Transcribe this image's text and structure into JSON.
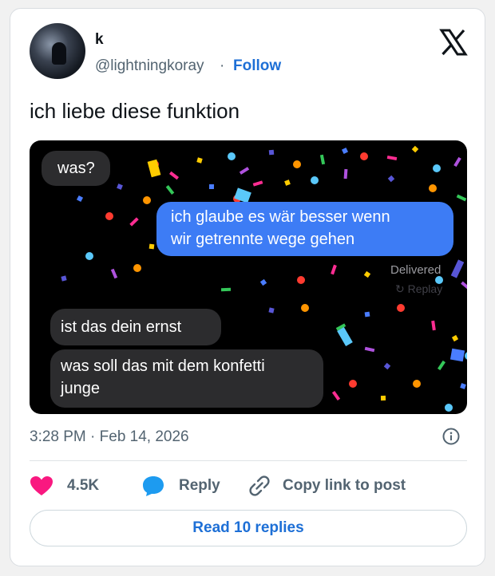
{
  "author": {
    "name": "k",
    "handle": "@lightningkoray",
    "separator": "·",
    "follow_label": "Follow"
  },
  "tweet": {
    "text": "ich liebe diese funktion",
    "timestamp": "3:28 PM · Feb 14, 2026"
  },
  "media": {
    "messages": [
      {
        "side": "left",
        "text": "was?"
      },
      {
        "side": "right",
        "line1": "ich glaube es wär besser wenn",
        "line2": "wir getrennte wege gehen"
      },
      {
        "side": "left",
        "text": "ist das dein ernst"
      },
      {
        "side": "left",
        "line1": "was soll das mit dem konfetti",
        "line2": "junge"
      }
    ],
    "status": "Delivered",
    "replay_label": "↻ Replay"
  },
  "actions": {
    "like_count": "4.5K",
    "reply_label": "Reply",
    "copy_label": "Copy link to post"
  },
  "read_replies_label": "Read 10 replies",
  "colors": {
    "link": "#1d6fd6",
    "heart": "#f91880",
    "reply_icon": "#1d9bf0",
    "bubble_blue": "#3d7cf5",
    "bubble_gray": "#2c2c2e"
  },
  "icons": [
    "x-logo-icon",
    "heart-icon",
    "reply-bubble-icon",
    "link-icon",
    "info-icon"
  ]
}
